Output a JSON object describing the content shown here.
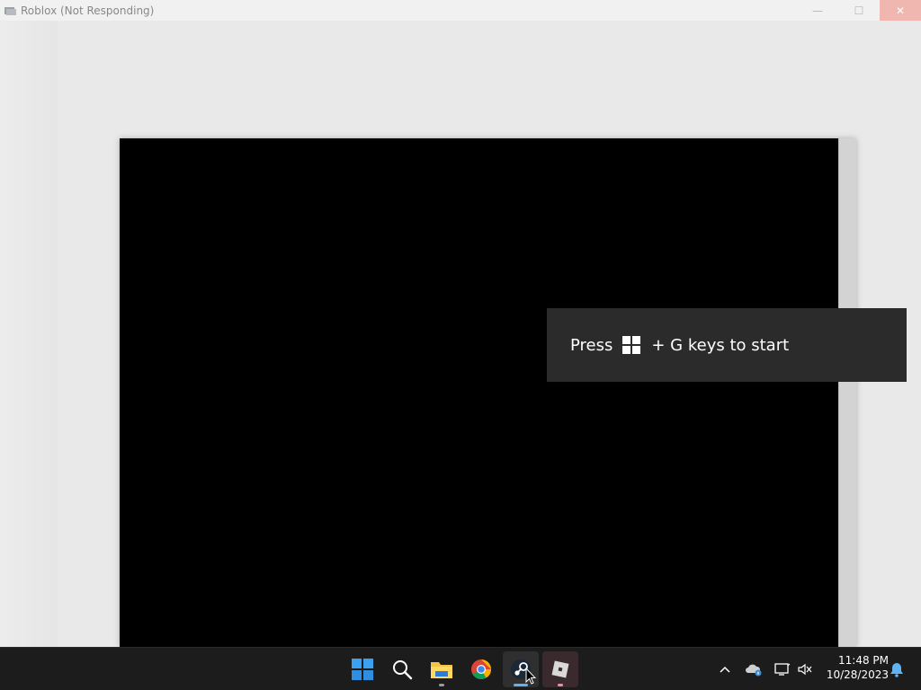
{
  "window": {
    "title": "Roblox (Not Responding)",
    "controls": {
      "minimize": "—",
      "maximize": "☐",
      "close": "✕"
    }
  },
  "toast": {
    "press_text": "Press",
    "keys_text": "+ G keys to start"
  },
  "taskbar": {
    "apps": [
      {
        "name": "start",
        "icon": "windows-logo-icon"
      },
      {
        "name": "search",
        "icon": "search-icon"
      },
      {
        "name": "file-explorer",
        "icon": "folder-icon"
      },
      {
        "name": "chrome",
        "icon": "chrome-icon"
      },
      {
        "name": "steam",
        "icon": "steam-icon"
      },
      {
        "name": "roblox",
        "icon": "roblox-icon"
      }
    ],
    "clock": {
      "time": "11:48 PM",
      "date": "10/28/2023"
    }
  },
  "colors": {
    "taskbar_bg": "#1c1c1c",
    "toast_bg": "#2b2b2b",
    "accent": "#5eb3f0",
    "close_button": "#f0b6b0"
  }
}
